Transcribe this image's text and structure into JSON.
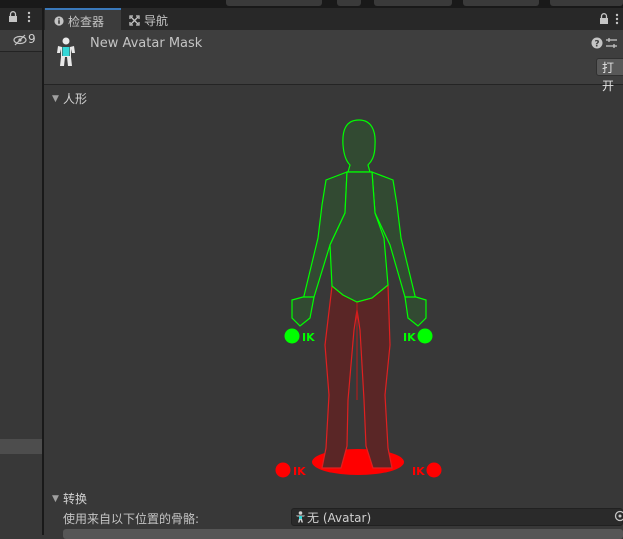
{
  "left_panel": {
    "lock_icon": "lock-icon",
    "menu_icon": "kebab-menu-icon",
    "visibility_count": "9"
  },
  "tabs": [
    {
      "label": "检查器",
      "icon": "info-icon"
    },
    {
      "label": "导航",
      "icon": "navigation-icon"
    }
  ],
  "inspector": {
    "asset_name": "New Avatar Mask",
    "open_button": "打开",
    "help_icon": "help-icon",
    "settings_icon": "preset-settings-icon"
  },
  "humanoid": {
    "header": "人形",
    "ik_label": "IK",
    "active_color": "#00ff00",
    "inactive_color": "#ff0000"
  },
  "transform": {
    "header": "转换",
    "skeleton_label": "使用来自以下位置的骨骼:",
    "skeleton_value": "无 (Avatar)"
  }
}
